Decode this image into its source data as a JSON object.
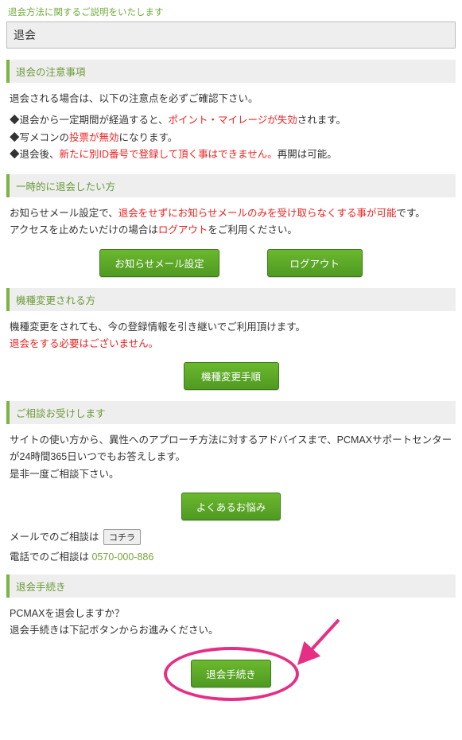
{
  "intro": "退会方法に関するご説明をいたします",
  "title": "退会",
  "notes": {
    "header": "退会の注意事項",
    "lead": "退会される場合は、以下の注意点を必ずご確認下さい。",
    "b1_1": "◆退会から一定期間が経過すると、",
    "b1_red": "ポイント・マイレージが失効",
    "b1_2": "されます。",
    "b2_1": "◆写メコンの",
    "b2_red": "投票が無効",
    "b2_2": "になります。",
    "b3_1": "◆退会後、",
    "b3_red": "新たに別ID番号で登録して頂く事はできません。",
    "b3_2": "再開は可能。"
  },
  "temp": {
    "header": "一時的に退会したい方",
    "l1_1": "お知らせメール設定で、",
    "l1_red": "退会をせずにお知らせメールのみを受け取らなくする事が可能",
    "l1_2": "です。",
    "l2_1": "アクセスを止めたいだけの場合は",
    "l2_red": "ログアウト",
    "l2_2": "をご利用ください。",
    "btn_mail": "お知らせメール設定",
    "btn_logout": "ログアウト"
  },
  "model": {
    "header": "機種変更される方",
    "l1": "機種変更をされても、今の登録情報を引き継いでご利用頂けます。",
    "l2_red": "退会をする必要はございません。",
    "btn": "機種変更手順"
  },
  "consult": {
    "header": "ご相談お受けします",
    "body": "サイトの使い方から、異性へのアプローチ方法に対するアドバイスまで、PCMAXサポートセンターが24時間365日いつでもお答えします。\n是非一度ご相談下さい。",
    "btn": "よくあるお悩み",
    "mail_label": "メールでのご相談は",
    "mail_btn": "コチラ",
    "phone_label": "電話でのご相談は ",
    "phone_num": "0570-000-886"
  },
  "proc": {
    "header": "退会手続き",
    "q": "PCMAXを退会しますか？",
    "hint": "退会手続きは下記ボタンからお進みください。",
    "btn": "退会手続き"
  }
}
